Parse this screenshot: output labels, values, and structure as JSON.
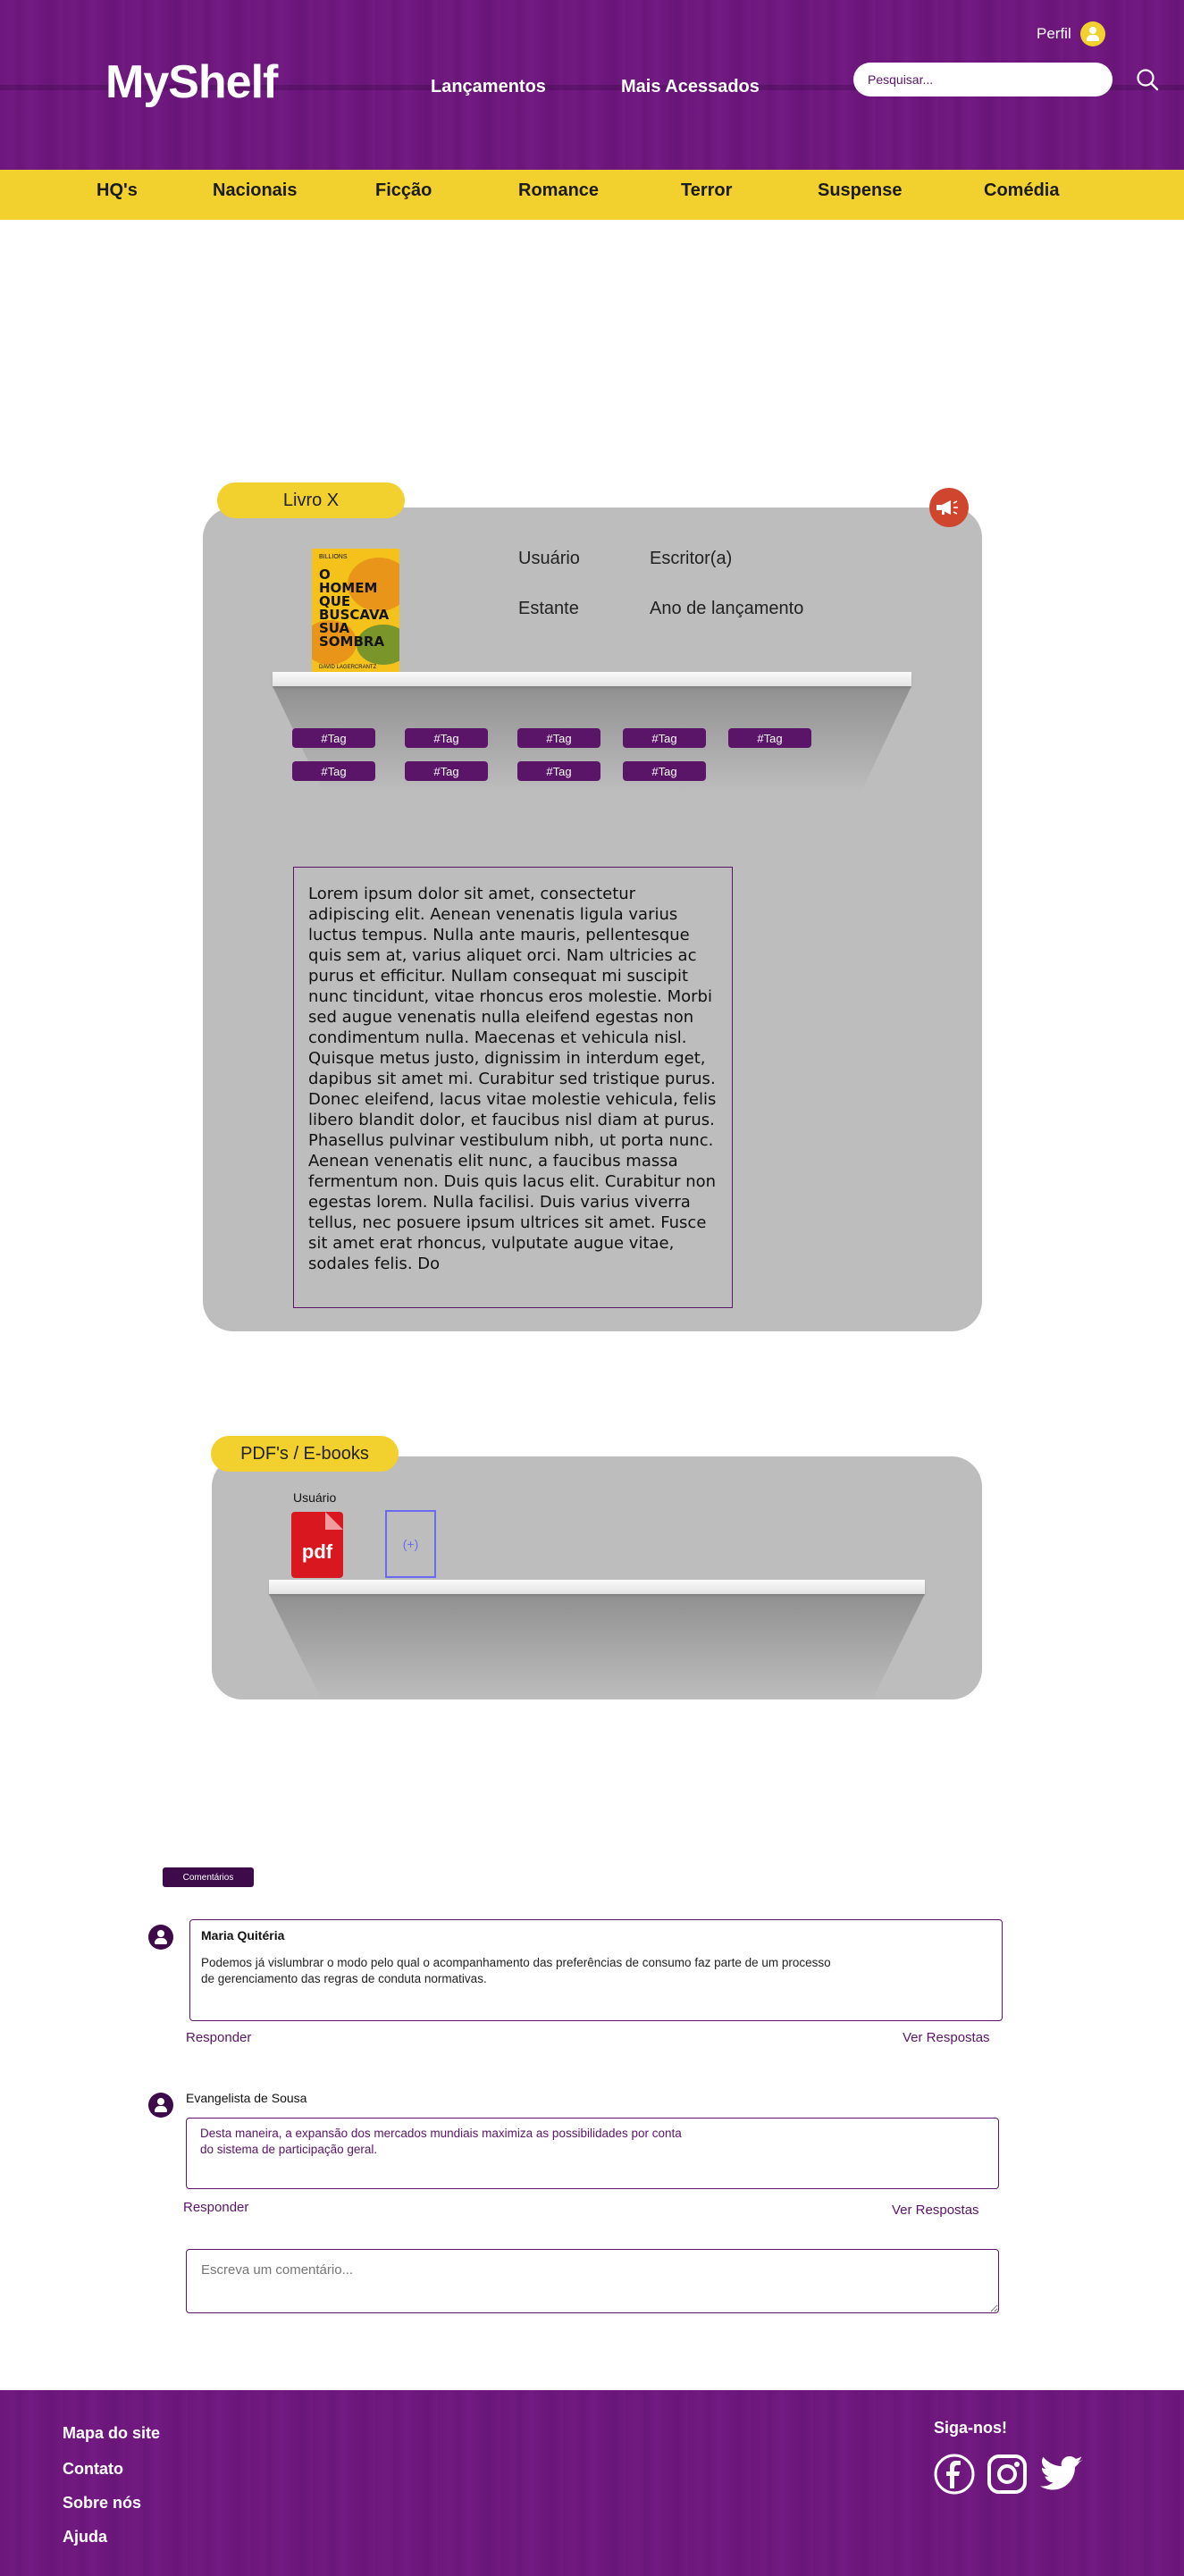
{
  "header": {
    "logo": "MyShelf",
    "nav": [
      "Lançamentos",
      "Mais Acessados"
    ],
    "profile_label": "Perfil",
    "search_placeholder": "Pesquisar..."
  },
  "categories": [
    "HQ's",
    "Nacionais",
    "Ficção",
    "Romance",
    "Terror",
    "Suspense",
    "Comédia"
  ],
  "book": {
    "section_label": "Livro X",
    "cover": {
      "publisher": "BILLIONS",
      "title": "O HOMEM QUE BUSCAVA SUA SOMBRA",
      "author": "DAVID LAGERCRANTZ"
    },
    "fields": {
      "user": "Usuário",
      "writer": "Escritor(a)",
      "shelf": "Estante",
      "release_year": "Ano de lançamento"
    },
    "tags": [
      "#Tag",
      "#Tag",
      "#Tag",
      "#Tag",
      "#Tag",
      "#Tag",
      "#Tag",
      "#Tag",
      "#Tag"
    ],
    "description": "Lorem ipsum dolor sit amet, consectetur adipiscing elit. Aenean venenatis ligula varius luctus tempus. Nulla ante mauris, pellentesque quis sem at, varius aliquet orci. Nam ultricies ac purus et efficitur. Nullam consequat mi suscipit nunc tincidunt, vitae rhoncus eros molestie. Morbi sed augue venenatis nulla eleifend egestas non condimentum nulla. Maecenas et vehicula nisl. Quisque metus justo, dignissim in interdum eget, dapibus sit amet mi. Curabitur sed tristique purus. Donec eleifend, lacus vitae molestie vehicula, felis libero blandit dolor, et faucibus nisl diam at purus. Phasellus pulvinar vestibulum nibh, ut porta nunc. Aenean venenatis elit nunc, a faucibus massa fermentum non. Duis quis lacus elit. Curabitur non egestas lorem. Nulla facilisi. Duis varius viverra tellus, nec posuere ipsum ultrices sit amet. Fusce sit amet erat rhoncus, vulputate augue vitae, sodales felis. Do"
  },
  "pdfs": {
    "section_label": "PDF's / E-books",
    "user_label": "Usuário",
    "pdf_label": "pdf",
    "add_label": "(+)"
  },
  "comments": {
    "badge": "Comentários",
    "items": [
      {
        "author": "Maria Quitéria",
        "text": "Podemos já vislumbrar o modo pelo qual o acompanhamento das preferências de consumo faz parte de um processo de gerenciamento das regras de conduta normativas.",
        "reply": "Responder",
        "view_replies": "Ver Respostas"
      },
      {
        "author": "Evangelista de Sousa",
        "text": "Desta maneira, a expansão dos mercados mundiais maximiza as possibilidades por conta do sistema de participação geral.",
        "reply": "Responder",
        "view_replies": "Ver Respostas"
      }
    ],
    "input_placeholder": "Escreva um comentário..."
  },
  "footer": {
    "links": [
      "Mapa do site",
      "Contato",
      "Sobre nós",
      "Ajuda"
    ],
    "follow_label": "Siga-nos!",
    "social": [
      "facebook-icon",
      "instagram-icon",
      "twitter-icon"
    ]
  },
  "colors": {
    "brand_purple": "#6e167d",
    "accent_yellow": "#f2d12e",
    "card_gray": "#bdbdbd",
    "report_red": "#d0452e"
  }
}
